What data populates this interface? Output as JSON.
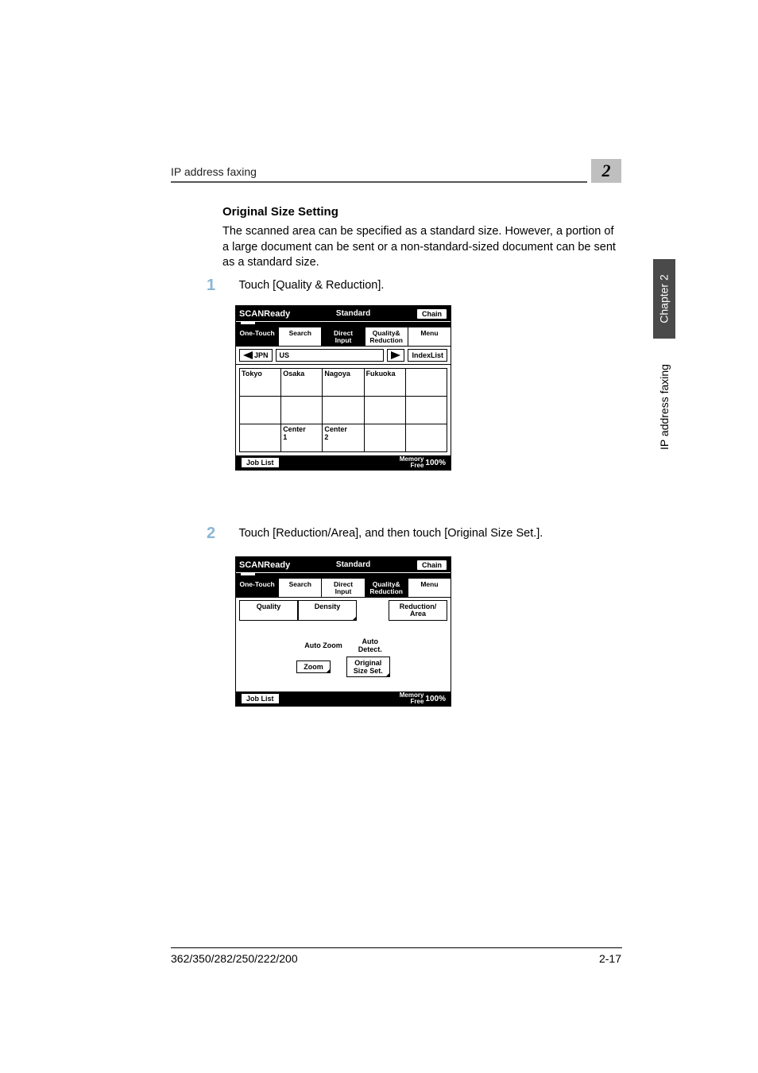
{
  "running_head": "IP address faxing",
  "chapter_badge": "2",
  "side_chapter": "Chapter 2",
  "side_topic": "IP address faxing",
  "section_title": "Original Size Setting",
  "intro_para": "The scanned area can be specified as a standard size. However, a portion of a large document can be sent or a non-standard-sized document can be sent as a standard size.",
  "steps": {
    "s1_num": "1",
    "s1_text": "Touch [Quality & Reduction].",
    "s2_num": "2",
    "s2_text": "Touch [Reduction/Area], and then touch [Original Size Set.]."
  },
  "lcd": {
    "ready": "SCANReady",
    "standard": "Standard",
    "chain": "Chain",
    "tabs": {
      "one_touch": "One-Touch",
      "search": "Search",
      "direct_input": "Direct\nInput",
      "quality_reduction": "Quality&\nReduction",
      "menu": "Menu"
    },
    "row2": {
      "jpn": "JPN",
      "us": "US",
      "indexlist": "IndexList"
    },
    "grid": {
      "r0c0": "Tokyo",
      "r0c1": "Osaka",
      "r0c2": "Nagoya",
      "r0c3": "Fukuoka",
      "r0c4": "",
      "r1c0": "",
      "r1c1": "",
      "r1c2": "",
      "r1c3": "",
      "r1c4": "",
      "r2c0": "",
      "r2c1": "Center\n1",
      "r2c2": "Center\n2",
      "r2c3": "",
      "r2c4": ""
    },
    "job_list": "Job List",
    "memory_label": "Memory\nFree",
    "memory_pct": "100%"
  },
  "lcd2": {
    "quality": "Quality",
    "density": "Density",
    "reduction_area": "Reduction/\nArea",
    "auto_zoom": "Auto Zoom",
    "auto_detect": "Auto\nDetect.",
    "zoom": "Zoom",
    "original_size_set": "Original\nSize Set."
  },
  "footer_left": "362/350/282/250/222/200",
  "footer_right": "2-17",
  "chart_data": {
    "type": "table",
    "note": "No chart data; this is a document page with UI screenshots."
  }
}
